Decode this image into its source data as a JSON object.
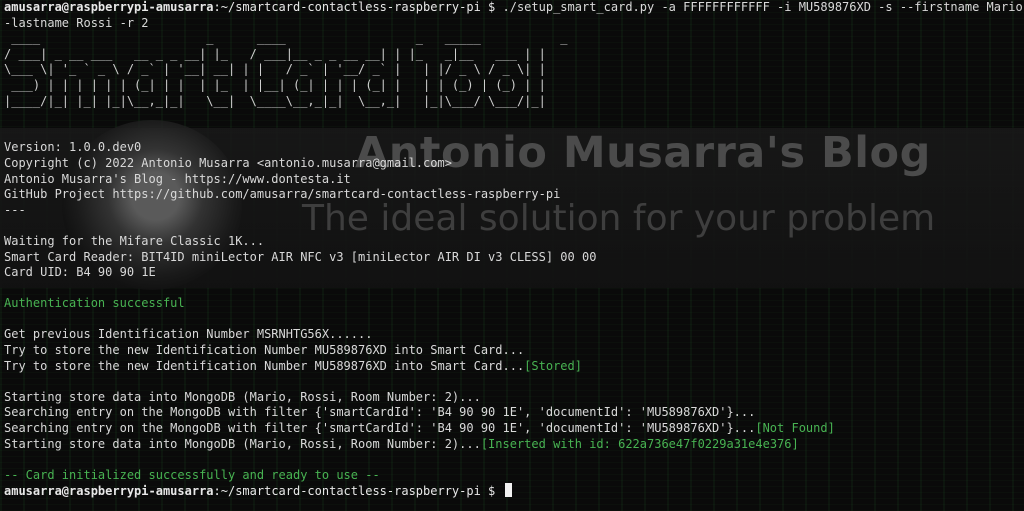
{
  "terminal": {
    "prompt_user": "amusarra@raspberrypi-amusarra",
    "prompt_path": ":~/smartcard-contactless-raspberry-pi $ ",
    "command": "./setup_smart_card.py -a FFFFFFFFFFFF -i MU589876XD -s --firstname Mario -",
    "command_cont": "-lastname Rossi -r 2",
    "banner": [
      " ____                       _      ____                  _   _____           _ ",
      "/ ___| _ __ ___   __ _ _ __| |_   / ___|__ _ _ __ __| | |_   _|__   ___ | |",
      "\\___ \\| '_ ` _ \\ / _` | '__| __| | |   / _` | '__/ _` |   | |/ _ \\ / _ \\| |",
      " ___) | | | | | | (_| | |  | |_  | |__| (_| | | | (_| |   | | (_) | (_) | |",
      "|____/|_| |_| |_|\\__,_|_|   \\__|  \\____\\__,_|_|  \\__,_|   |_|\\___/ \\___/|_|"
    ],
    "info": [
      "Version: 1.0.0.dev0",
      "Copyright (c) 2022 Antonio Musarra <antonio.musarra@gmail.com>",
      "Antonio Musarra's Blog - https://www.dontesta.it",
      "GitHub Project https://github.com/amusarra/smartcard-contactless-raspberry-pi",
      "---"
    ],
    "reader": [
      "Waiting for the Mifare Classic 1K...",
      "Smart Card Reader: BIT4ID miniLector AIR NFC v3 [miniLector AIR DI v3 CLESS] 00 00",
      "Card UID: B4 90 90 1E"
    ],
    "auth": "Authentication successful",
    "id_lines": [
      "Get previous Identification Number MSRNHTG56X......",
      "Try to store the new Identification Number MU589876XD into Smart Card...",
      "Try to store the new Identification Number MU589876XD into Smart Card..."
    ],
    "stored_tag": "[Stored]",
    "mongo_lines": [
      "Starting store data into MongoDB (Mario, Rossi, Room Number: 2)...",
      "Searching entry on the MongoDB with filter {'smartCardId': 'B4 90 90 1E', 'documentId': 'MU589876XD'}...",
      "Searching entry on the MongoDB with filter {'smartCardId': 'B4 90 90 1E', 'documentId': 'MU589876XD'}...",
      "Starting store data into MongoDB (Mario, Rossi, Room Number: 2)..."
    ],
    "not_found_tag": "[Not Found]",
    "inserted_tag": "[Inserted with id: 622a736e47f0229a31e4e376]",
    "final_msg": "-- Card initialized successfully and ready to use --"
  },
  "background": {
    "blog_title": "Antonio Musarra's Blog",
    "blog_tagline": "The ideal solution for your problem"
  },
  "colors": {
    "background": "#0a0a0a",
    "text": "#d9d9d9",
    "success_green": "#48b352"
  }
}
